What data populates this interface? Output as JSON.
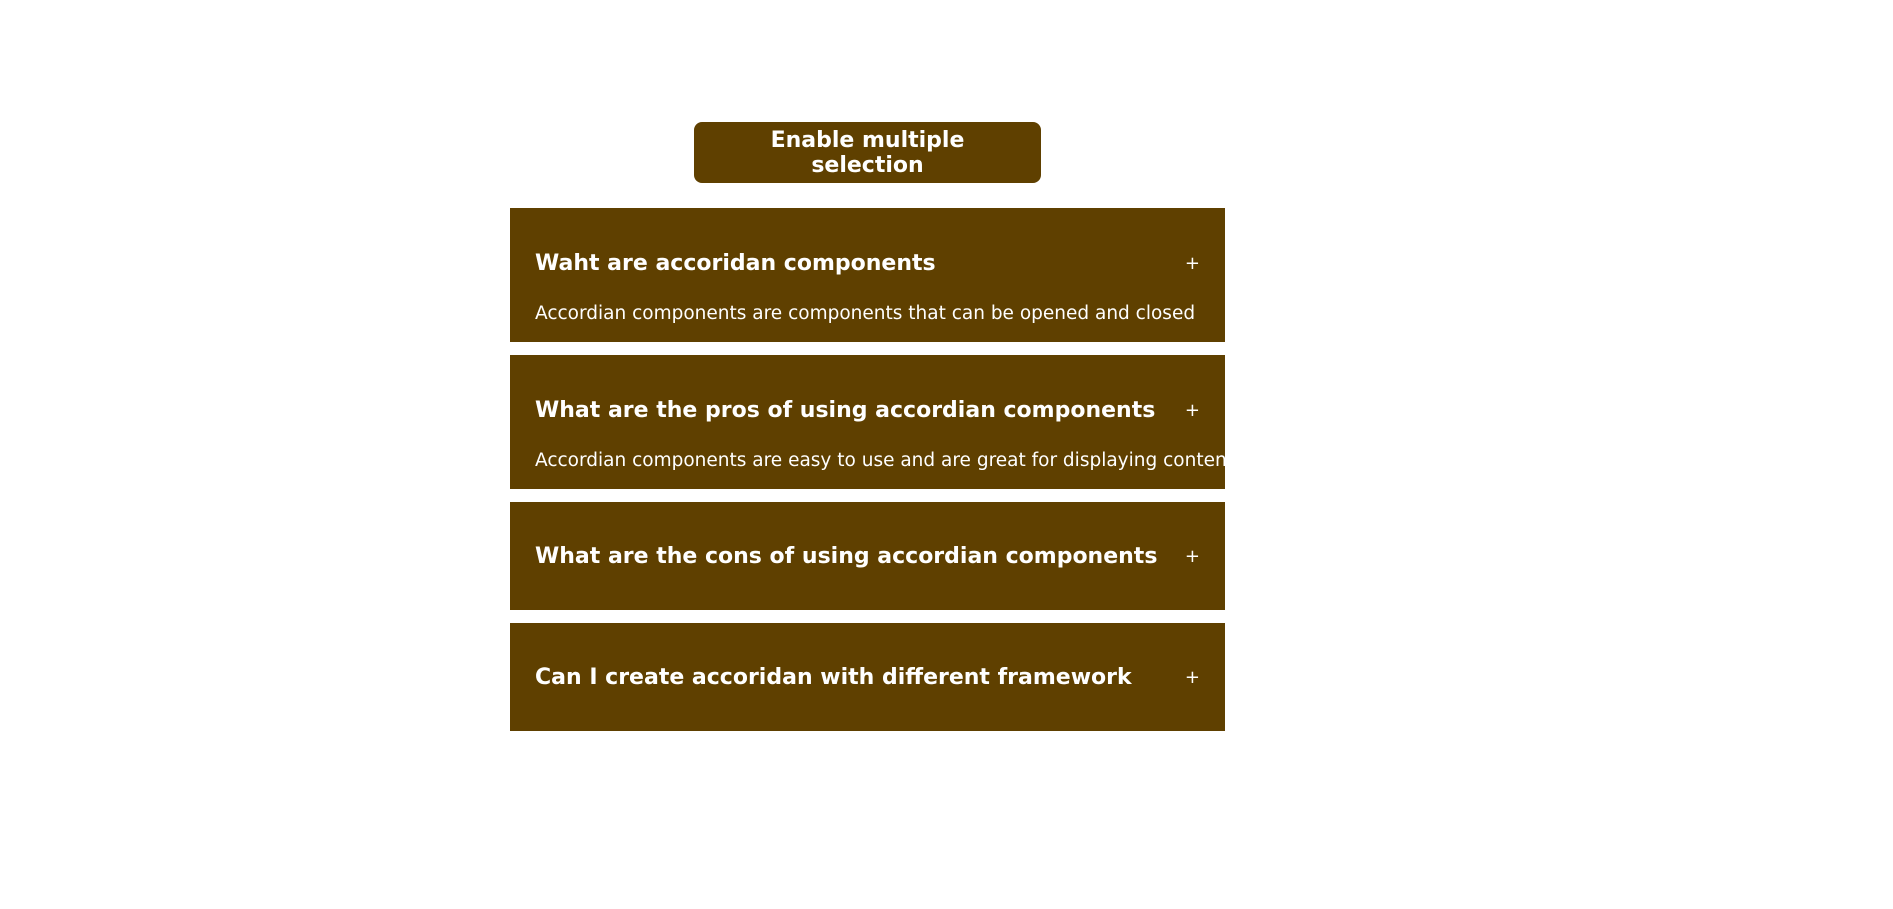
{
  "toggle": {
    "label": "Enable multiple selection"
  },
  "colors": {
    "accent": "#5f4000",
    "text": "#ffffff",
    "background": "#ffffff"
  },
  "items": [
    {
      "title": "Waht are accoridan components",
      "toggle": "+",
      "content": "Accordian components are components that can be opened and closed",
      "open": true
    },
    {
      "title": "What are the pros of using accordian components",
      "toggle": "+",
      "content": "Accordian components are easy to use and are great for displaying content",
      "open": true
    },
    {
      "title": "What are the cons of using accordian components",
      "toggle": "+",
      "content": "",
      "open": false
    },
    {
      "title": "Can I create accoridan with different framework",
      "toggle": "+",
      "content": "",
      "open": false
    }
  ]
}
